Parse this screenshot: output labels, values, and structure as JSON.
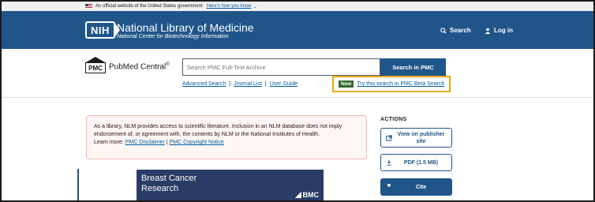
{
  "gov_banner": {
    "text": "An official website of the United States government",
    "link": "Here's how you know"
  },
  "header": {
    "logo": "NIH",
    "title": "National Library of Medicine",
    "subtitle": "National Center for Biotechnology Information",
    "search_label": "Search",
    "login_label": "Log in"
  },
  "pmc": {
    "logo_mark": "PMC",
    "name": "PubMed Central",
    "reg": "®",
    "search_placeholder": "Search PMC Full-Text Archive",
    "search_button": "Search in PMC",
    "links": [
      "Advanced Search",
      "Journal List",
      "User Guide"
    ],
    "new_badge": "New",
    "beta_link": "Try this search in PMC Beta Search"
  },
  "notice": {
    "text": "As a library, NLM provides access to scientific literature. Inclusion in an NLM database does not imply endorsement of, or agreement with, the contents by NLM or the National Institutes of Health.",
    "learn_more": "Learn more:",
    "disclaimer_link": "PMC Disclaimer",
    "separator": "|",
    "copyright_link": "PMC Copyright Notice"
  },
  "ad": {
    "title": "Breast Cancer Research",
    "brand": "BMC"
  },
  "actions": {
    "heading": "ACTIONS",
    "view_publisher": "View on publisher site",
    "pdf": "PDF (1.5 MB)",
    "cite": "Cite"
  },
  "colors": {
    "header_bg": "#20558a",
    "link": "#005ea2",
    "highlight_border": "#f2a900",
    "notice_bg": "#fff5f3",
    "ad_bg": "#283c66"
  }
}
